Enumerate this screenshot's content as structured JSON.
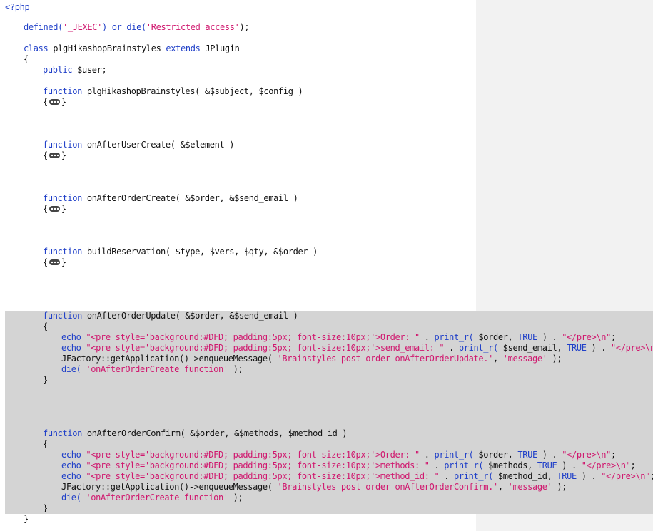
{
  "editor": {
    "lines": [
      {
        "parts": [
          {
            "t": "<?php",
            "c": "kw"
          }
        ]
      },
      {
        "parts": [
          {
            "t": "defined(",
            "c": "kw"
          },
          {
            "t": "'_JEXEC'",
            "c": "str"
          },
          {
            "t": ") ",
            "c": "kw"
          },
          {
            "t": "or ",
            "c": "kw"
          },
          {
            "t": "die(",
            "c": "kw"
          },
          {
            "t": "'Restricted access'",
            "c": "str"
          },
          {
            "t": ");",
            "c": ""
          }
        ]
      },
      {
        "parts": [
          {
            "t": "class ",
            "c": "kw"
          },
          {
            "t": "plgHikashopBrainstyles ",
            "c": ""
          },
          {
            "t": "extends ",
            "c": "kw"
          },
          {
            "t": "JPlugin",
            "c": ""
          }
        ]
      },
      {
        "parts": [
          {
            "t": "{",
            "c": ""
          }
        ]
      },
      {
        "parts": [
          {
            "t": "public ",
            "c": "kw"
          },
          {
            "t": "$user;",
            "c": ""
          }
        ]
      },
      {
        "parts": [
          {
            "t": "function ",
            "c": "kw"
          },
          {
            "t": "plgHikashopBrainstyles( &$subject, $config )",
            "c": ""
          }
        ]
      },
      {
        "parts": [
          {
            "t": "{",
            "c": ""
          },
          {
            "t": "",
            "c": "fold"
          },
          {
            "t": "}",
            "c": ""
          }
        ]
      },
      {
        "parts": [
          {
            "t": "function ",
            "c": "kw"
          },
          {
            "t": "onAfterUserCreate( &$element )",
            "c": ""
          }
        ]
      },
      {
        "parts": [
          {
            "t": "{",
            "c": ""
          },
          {
            "t": "",
            "c": "fold"
          },
          {
            "t": "}",
            "c": ""
          }
        ]
      },
      {
        "parts": [
          {
            "t": "function ",
            "c": "kw"
          },
          {
            "t": "onAfterOrderCreate( &$order, &$send_email )",
            "c": ""
          }
        ]
      },
      {
        "parts": [
          {
            "t": "{",
            "c": ""
          },
          {
            "t": "",
            "c": "fold"
          },
          {
            "t": "}",
            "c": ""
          }
        ]
      },
      {
        "parts": [
          {
            "t": "function ",
            "c": "kw"
          },
          {
            "t": "buildReservation( $type, $vers, $qty, &$order )",
            "c": ""
          }
        ]
      },
      {
        "parts": [
          {
            "t": "{",
            "c": ""
          },
          {
            "t": "",
            "c": "fold"
          },
          {
            "t": "}",
            "c": ""
          }
        ]
      },
      {
        "parts": [
          {
            "t": "function ",
            "c": "kw"
          },
          {
            "t": "onAfterOrderUpdate( &$order, &$send_email )",
            "c": ""
          }
        ]
      },
      {
        "parts": [
          {
            "t": "{",
            "c": ""
          }
        ]
      },
      {
        "parts": [
          {
            "t": "echo ",
            "c": "kw"
          },
          {
            "t": "\"<pre style='background:#DFD; padding:5px; font-size:10px;'>Order: \"",
            "c": "str"
          },
          {
            "t": " . ",
            "c": ""
          },
          {
            "t": "print_r(",
            "c": "kw"
          },
          {
            "t": " $order, ",
            "c": ""
          },
          {
            "t": "TRUE",
            "c": "kw"
          },
          {
            "t": " ) . ",
            "c": ""
          },
          {
            "t": "\"</pre>\\n\"",
            "c": "str"
          },
          {
            "t": ";",
            "c": ""
          }
        ]
      },
      {
        "parts": [
          {
            "t": "echo ",
            "c": "kw"
          },
          {
            "t": "\"<pre style='background:#DFD; padding:5px; font-size:10px;'>send_email: \"",
            "c": "str"
          },
          {
            "t": " . ",
            "c": ""
          },
          {
            "t": "print_r(",
            "c": "kw"
          },
          {
            "t": " $send_email, ",
            "c": ""
          },
          {
            "t": "TRUE",
            "c": "kw"
          },
          {
            "t": " ) . ",
            "c": ""
          },
          {
            "t": "\"</pre>\\n\"",
            "c": "str"
          },
          {
            "t": ";",
            "c": ""
          }
        ]
      },
      {
        "parts": [
          {
            "t": "JFactory::getApplication()->enqueueMessage( ",
            "c": ""
          },
          {
            "t": "'Brainstyles post order onAfterOrderUpdate.'",
            "c": "str"
          },
          {
            "t": ", ",
            "c": ""
          },
          {
            "t": "'message'",
            "c": "str"
          },
          {
            "t": " );",
            "c": ""
          }
        ]
      },
      {
        "parts": [
          {
            "t": "die( ",
            "c": "kw"
          },
          {
            "t": "'onAfterOrderCreate function'",
            "c": "str"
          },
          {
            "t": " );",
            "c": ""
          }
        ]
      },
      {
        "parts": [
          {
            "t": "}",
            "c": ""
          }
        ]
      },
      {
        "parts": [
          {
            "t": "function ",
            "c": "kw"
          },
          {
            "t": "onAfterOrderConfirm( &$order, &$methods, $method_id )",
            "c": ""
          }
        ]
      },
      {
        "parts": [
          {
            "t": "{",
            "c": ""
          }
        ]
      },
      {
        "parts": [
          {
            "t": "echo ",
            "c": "kw"
          },
          {
            "t": "\"<pre style='background:#DFD; padding:5px; font-size:10px;'>Order: \"",
            "c": "str"
          },
          {
            "t": " . ",
            "c": ""
          },
          {
            "t": "print_r(",
            "c": "kw"
          },
          {
            "t": " $order, ",
            "c": ""
          },
          {
            "t": "TRUE",
            "c": "kw"
          },
          {
            "t": " ) . ",
            "c": ""
          },
          {
            "t": "\"</pre>\\n\"",
            "c": "str"
          },
          {
            "t": ";",
            "c": ""
          }
        ]
      },
      {
        "parts": [
          {
            "t": "echo ",
            "c": "kw"
          },
          {
            "t": "\"<pre style='background:#DFD; padding:5px; font-size:10px;'>methods: \"",
            "c": "str"
          },
          {
            "t": " . ",
            "c": ""
          },
          {
            "t": "print_r(",
            "c": "kw"
          },
          {
            "t": " $methods, ",
            "c": ""
          },
          {
            "t": "TRUE",
            "c": "kw"
          },
          {
            "t": " ) . ",
            "c": ""
          },
          {
            "t": "\"</pre>\\n\"",
            "c": "str"
          },
          {
            "t": ";",
            "c": ""
          }
        ]
      },
      {
        "parts": [
          {
            "t": "echo ",
            "c": "kw"
          },
          {
            "t": "\"<pre style='background:#DFD; padding:5px; font-size:10px;'>method_id: \"",
            "c": "str"
          },
          {
            "t": " . ",
            "c": ""
          },
          {
            "t": "print_r(",
            "c": "kw"
          },
          {
            "t": " $method_id, ",
            "c": ""
          },
          {
            "t": "TRUE",
            "c": "kw"
          },
          {
            "t": " ) . ",
            "c": ""
          },
          {
            "t": "\"</pre>\\n\"",
            "c": "str"
          },
          {
            "t": ";",
            "c": ""
          }
        ]
      },
      {
        "parts": [
          {
            "t": "JFactory::getApplication()->enqueueMessage( ",
            "c": ""
          },
          {
            "t": "'Brainstyles post order onAfterOrderConfirm.'",
            "c": "str"
          },
          {
            "t": ", ",
            "c": ""
          },
          {
            "t": "'message'",
            "c": "str"
          },
          {
            "t": " );",
            "c": ""
          }
        ]
      },
      {
        "parts": [
          {
            "t": "die( ",
            "c": "kw"
          },
          {
            "t": "'onAfterOrderCreate function'",
            "c": "str"
          },
          {
            "t": " );",
            "c": ""
          }
        ]
      },
      {
        "parts": [
          {
            "t": "}",
            "c": ""
          }
        ]
      },
      {
        "parts": [
          {
            "t": "}",
            "c": ""
          }
        ]
      }
    ]
  },
  "colors": {
    "keyword": "#1f3fc8",
    "string": "#d0176e",
    "selection": "#d4d4d4",
    "margin": "#f2f2f2"
  },
  "icons": {
    "fold": "collapsed-code-icon"
  }
}
